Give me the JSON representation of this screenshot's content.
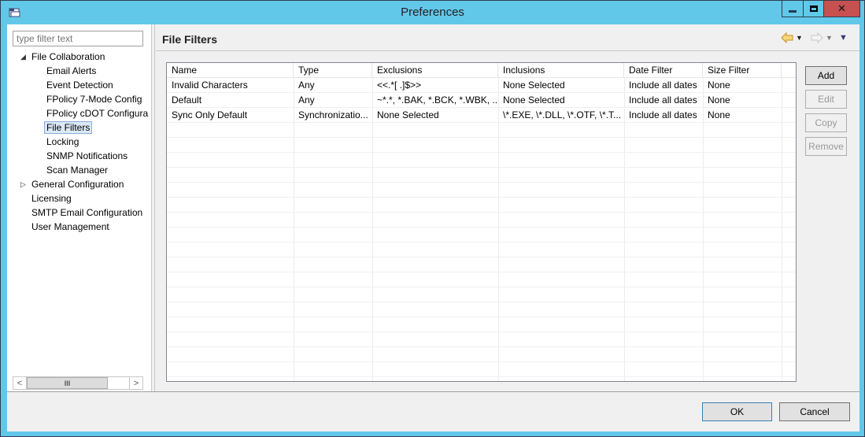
{
  "window": {
    "title": "Preferences",
    "controls": {
      "minimize": "minimize",
      "maximize": "maximize",
      "close": "close"
    }
  },
  "sidebar": {
    "filter_placeholder": "type filter text",
    "tree": [
      {
        "label": "File Collaboration",
        "level": 0,
        "expanded": true,
        "has_children": true
      },
      {
        "label": "Email Alerts",
        "level": 1
      },
      {
        "label": "Event Detection",
        "level": 1
      },
      {
        "label": "FPolicy 7-Mode Config",
        "level": 1
      },
      {
        "label": "FPolicy cDOT Configura",
        "level": 1
      },
      {
        "label": "File Filters",
        "level": 1,
        "selected": true
      },
      {
        "label": "Locking",
        "level": 1
      },
      {
        "label": "SNMP Notifications",
        "level": 1
      },
      {
        "label": "Scan Manager",
        "level": 1
      },
      {
        "label": "General Configuration",
        "level": 0,
        "expanded": false,
        "has_children": true
      },
      {
        "label": "Licensing",
        "level": 0
      },
      {
        "label": "SMTP Email Configuration",
        "level": 0
      },
      {
        "label": "User Management",
        "level": 0
      }
    ],
    "scrollbar": {
      "left_arrow": "<",
      "right_arrow": ">",
      "thumb_grip": "III"
    }
  },
  "page": {
    "title": "File Filters",
    "nav": {
      "back_icon": "back-arrow",
      "forward_icon": "forward-arrow",
      "menu_icon": "view-menu"
    }
  },
  "table": {
    "columns": [
      "Name",
      "Type",
      "Exclusions",
      "Inclusions",
      "Date Filter",
      "Size Filter"
    ],
    "rows": [
      [
        "Invalid Characters",
        "Any",
        "<<.*[ .]$>>",
        "None Selected",
        "Include all dates",
        "None"
      ],
      [
        "Default",
        "Any",
        "~*.*, *.BAK, *.BCK, *.WBK, ...",
        "None Selected",
        "Include all dates",
        "None"
      ],
      [
        "Sync Only Default",
        "Synchronizatio...",
        "None Selected",
        "\\*.EXE, \\*.DLL, \\*.OTF, \\*.T...",
        "Include all dates",
        "None"
      ]
    ]
  },
  "actions": {
    "add": "Add",
    "edit": "Edit",
    "copy": "Copy",
    "remove": "Remove"
  },
  "footer": {
    "ok": "OK",
    "cancel": "Cancel"
  },
  "colors": {
    "frame": "#62c8ea",
    "close_button": "#c75050",
    "selection": "#dbe9f7"
  }
}
